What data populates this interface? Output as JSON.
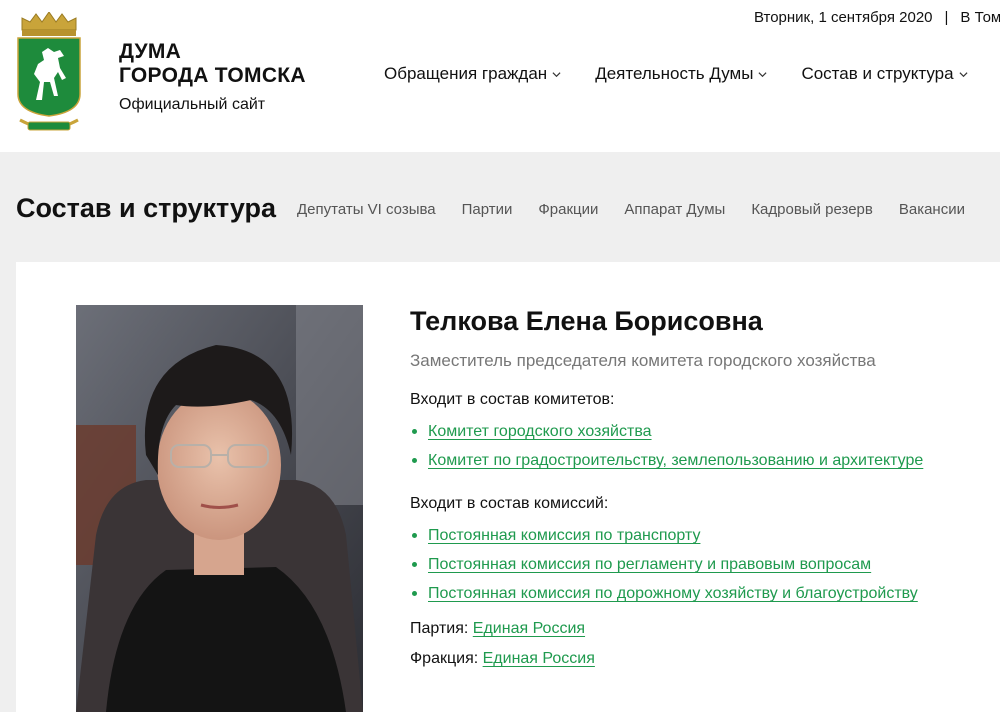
{
  "header": {
    "brand_line1": "ДУМА",
    "brand_line2": "ГОРОДА ТОМСКА",
    "brand_sub": "Официальный сайт",
    "date": "Вторник, 1 сентября 2020",
    "separator": "|",
    "city_prefix": "В Том",
    "nav": [
      {
        "label": "Обращения граждан"
      },
      {
        "label": "Деятельность Думы"
      },
      {
        "label": "Состав и структура"
      }
    ]
  },
  "section": {
    "title": "Состав и структура",
    "subnav": [
      "Депутаты VI созыва",
      "Партии",
      "Фракции",
      "Аппарат Думы",
      "Кадровый резерв",
      "Вакансии"
    ]
  },
  "profile": {
    "name": "Телкова Елена Борисовна",
    "position": "Заместитель председателя комитета городского хозяйства",
    "committees_heading": "Входит в состав комитетов:",
    "committees": [
      "Комитет городского хозяйства",
      "Комитет по градостроительству, землепользованию и архитектуре"
    ],
    "commissions_heading": "Входит в состав комиссий:",
    "commissions": [
      "Постоянная комиссия по транспорту",
      "Постоянная комиссия по регламенту и правовым вопросам",
      "Постоянная комиссия по дорожному хозяйству и благоустройству"
    ],
    "party_label": "Партия:",
    "party": "Единая Россия",
    "faction_label": "Фракция:",
    "faction": "Единая Россия"
  },
  "colors": {
    "link": "#1f9a4e",
    "band": "#efefef",
    "coat_green": "#1e8b3c",
    "coat_gold": "#c9a43a"
  },
  "icons": {
    "coat_of_arms": "tomsk-coat-of-arms-icon",
    "chevron": "chevron-down-icon",
    "bullet": "bullet-dot-icon"
  }
}
